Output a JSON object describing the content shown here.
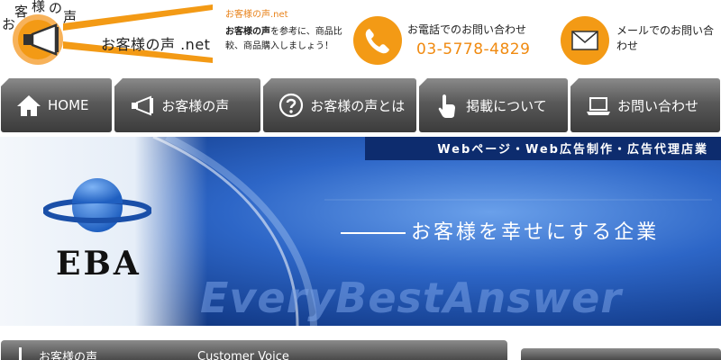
{
  "logo": {
    "arc_chars": [
      "お",
      "客",
      "様",
      "の",
      "声"
    ],
    "name": "お客様の声 .net"
  },
  "tagline": {
    "site": "お客様の声.net",
    "bold": "お客様の声",
    "rest": "を参考に、商品比較、商品購入しましょう！"
  },
  "contact": {
    "phone_label": "お電話でのお問い合わせ",
    "phone_number": "03-5778-4829",
    "mail_label": "メールでのお問い合わせ"
  },
  "nav": [
    {
      "label": "HOME",
      "icon": "home-icon"
    },
    {
      "label": "お客様の声",
      "icon": "megaphone-icon"
    },
    {
      "label": "お客様の声とは",
      "icon": "question-icon"
    },
    {
      "label": "掲載について",
      "icon": "pointer-hand-icon"
    },
    {
      "label": "お問い合わせ",
      "icon": "laptop-icon"
    }
  ],
  "hero": {
    "strip": "Webページ・Web広告制作・広告代理店業",
    "slogan": "お客様を幸せにする企業",
    "motto": "EveryBestAnswer",
    "brand": "EBA"
  },
  "section": {
    "title": "お客様の声",
    "subtitle": "Customer Voice"
  },
  "colors": {
    "accent_orange": "#f39a15",
    "nav_gray": "#595959",
    "hero_blue": "#2d66c7",
    "strip_navy": "#0d2c6e"
  }
}
